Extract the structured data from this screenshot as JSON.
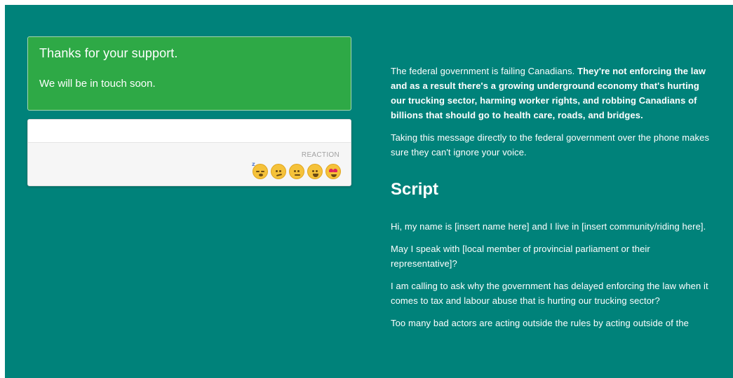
{
  "success": {
    "title": "Thanks for your support.",
    "message": "We will be in touch soon."
  },
  "reaction": {
    "label": "REACTION",
    "emojis": [
      {
        "name": "sleepy-face-icon"
      },
      {
        "name": "confused-face-icon"
      },
      {
        "name": "neutral-face-icon"
      },
      {
        "name": "grinning-face-icon"
      },
      {
        "name": "heart-eyes-face-icon"
      }
    ]
  },
  "content": {
    "intro_plain": "The federal government is failing Canadians. ",
    "intro_bold": "They're not enforcing the law and as a result there's a growing underground economy that's hurting our trucking sector, harming worker rights, and robbing Canadians of billions that should go to health care, roads, and bridges.",
    "para2": "Taking this message directly to the federal government over the phone makes sure they can't ignore your voice.",
    "script_heading": "Script",
    "script": [
      "Hi, my name is [insert name here] and I live in [insert community/riding here].",
      "May I speak with [local member of provincial parliament or their representative]?",
      "I am calling to ask why the government has delayed enforcing the law when it comes to tax and labour abuse that is hurting our trucking sector?",
      "Too many bad actors are acting outside the rules by acting outside of the"
    ]
  },
  "colors": {
    "background": "#00827a",
    "success": "#2ea946"
  }
}
